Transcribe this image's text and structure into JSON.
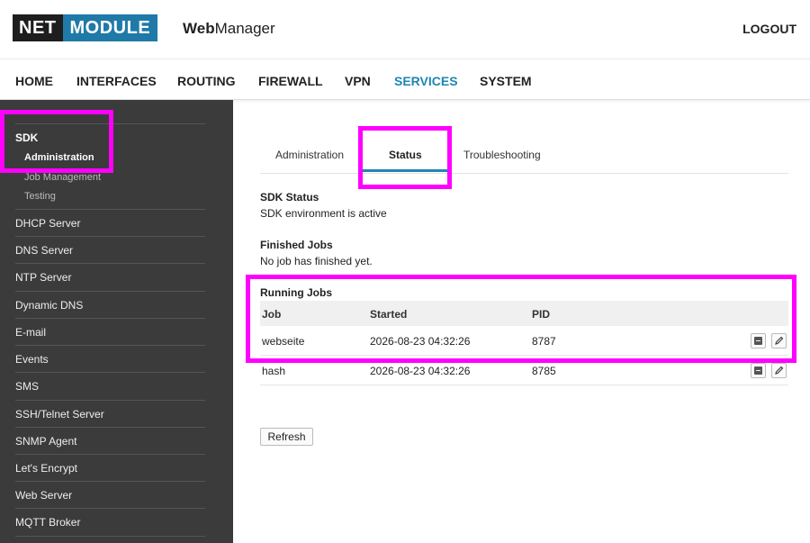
{
  "header": {
    "logo_part1": "NET",
    "logo_part2": "MODULE",
    "app_name_bold": "Web",
    "app_name_rest": "Manager",
    "logout_label": "LOGOUT"
  },
  "topnav": {
    "items": [
      "HOME",
      "INTERFACES",
      "ROUTING",
      "FIREWALL",
      "VPN",
      "SERVICES",
      "SYSTEM"
    ],
    "active": "SERVICES"
  },
  "sidebar": {
    "section": "SDK",
    "sub_items": [
      "Administration",
      "Job Management",
      "Testing"
    ],
    "active_sub": "Administration",
    "items": [
      "DHCP Server",
      "DNS Server",
      "NTP Server",
      "Dynamic DNS",
      "E-mail",
      "Events",
      "SMS",
      "SSH/Telnet Server",
      "SNMP Agent",
      "Let's Encrypt",
      "Web Server",
      "MQTT Broker"
    ]
  },
  "tabs": {
    "items": [
      "Administration",
      "Status",
      "Troubleshooting"
    ],
    "active": "Status"
  },
  "sdk_status": {
    "title": "SDK Status",
    "text": "SDK environment is active"
  },
  "finished_jobs": {
    "title": "Finished Jobs",
    "text": "No job has finished yet."
  },
  "running_jobs": {
    "title": "Running Jobs",
    "columns": [
      "Job",
      "Started",
      "PID"
    ],
    "rows": [
      {
        "job": "webseite",
        "started": "2026-08-23 04:32:26",
        "pid": "8787"
      },
      {
        "job": "hash",
        "started": "2026-08-23 04:32:26",
        "pid": "8785"
      }
    ]
  },
  "refresh_label": "Refresh",
  "colors": {
    "accent": "#1f86b1",
    "highlight": "#ff00ff",
    "sidebar_bg": "#3b3b3b"
  }
}
